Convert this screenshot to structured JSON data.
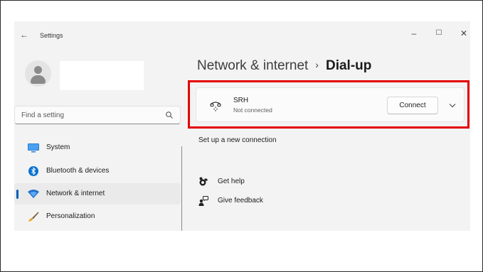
{
  "window": {
    "title": "Settings",
    "back_icon": "back-arrow-icon",
    "controls": {
      "minimize": "–",
      "maximize": "☐",
      "close": "✕"
    }
  },
  "sidebar": {
    "search": {
      "placeholder": "Find a setting",
      "icon": "search-icon"
    },
    "items": [
      {
        "label": "System",
        "icon": "system-icon",
        "selected": false
      },
      {
        "label": "Bluetooth & devices",
        "icon": "bluetooth-icon",
        "selected": false
      },
      {
        "label": "Network & internet",
        "icon": "wifi-icon",
        "selected": true
      },
      {
        "label": "Personalization",
        "icon": "brush-icon",
        "selected": false
      }
    ]
  },
  "main": {
    "breadcrumb": {
      "parent": "Network & internet",
      "separator": "›",
      "current": "Dial-up"
    },
    "connection": {
      "name": "SRH",
      "status": "Not connected",
      "connect_label": "Connect",
      "icon": "dial-up-icon",
      "expand_icon": "chevron-down-icon"
    },
    "setup_link": "Set up a new connection",
    "help": [
      {
        "label": "Get help",
        "icon": "help-icon"
      },
      {
        "label": "Give feedback",
        "icon": "feedback-icon"
      }
    ]
  },
  "colors": {
    "accent": "#005fb8",
    "highlight_border": "#e30000",
    "window_bg": "#f3f3f3"
  }
}
